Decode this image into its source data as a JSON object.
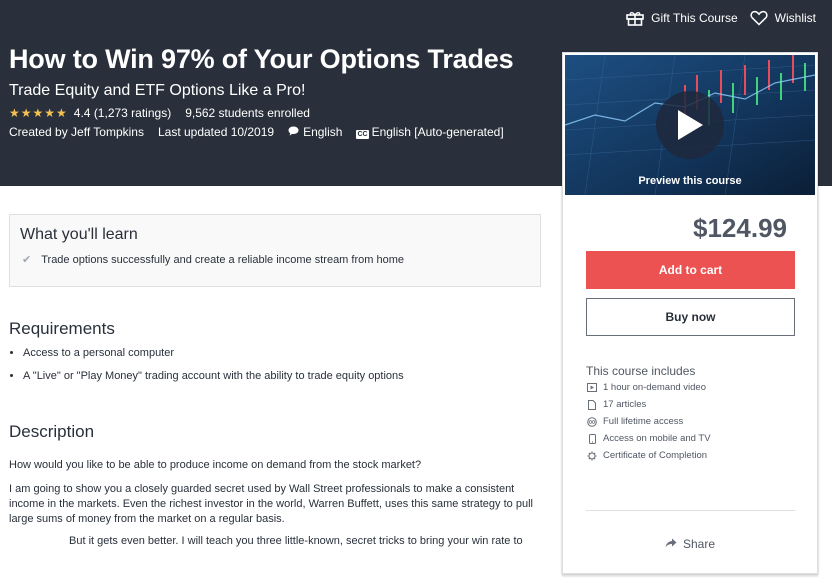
{
  "header": {
    "gift_label": "Gift This Course",
    "wishlist_label": "Wishlist",
    "title": "How to Win 97% of Your Options Trades",
    "subtitle": "Trade Equity and ETF Options Like a Pro!",
    "rating_stars": "★★★★★",
    "rating_text": "4.4 (1,273 ratings)",
    "students": "9,562 students enrolled",
    "created_by": "Created by Jeff Tompkins",
    "last_updated": "Last updated 10/2019",
    "language": "English",
    "captions": "English [Auto-generated]",
    "colors": {
      "background": "#29303b",
      "stars": "#f4c150"
    }
  },
  "sidebar": {
    "preview_label": "Preview this course",
    "price": "$124.99",
    "add_to_cart": "Add to cart",
    "buy_now": "Buy now",
    "includes_title": "This course includes",
    "includes": [
      {
        "icon": "video-icon",
        "text": "1 hour on-demand video"
      },
      {
        "icon": "file-icon",
        "text": "17 articles"
      },
      {
        "icon": "infinity-icon",
        "text": "Full lifetime access"
      },
      {
        "icon": "mobile-icon",
        "text": "Access on mobile and TV"
      },
      {
        "icon": "certificate-icon",
        "text": "Certificate of Completion"
      }
    ],
    "share_label": "Share",
    "colors": {
      "cart_button": "#ec5252"
    }
  },
  "learn": {
    "title": "What you'll learn",
    "items": [
      "Trade options successfully and create a reliable income stream from home"
    ]
  },
  "requirements": {
    "title": "Requirements",
    "items": [
      "Access to a personal computer",
      "A \"Live\" or \"Play Money\" trading account with the ability to trade equity options"
    ]
  },
  "description": {
    "title": "Description",
    "paragraphs": [
      "How would you like to be able to produce income on demand from the stock market?",
      "I am going to show you a closely guarded secret used by Wall Street professionals to make a consistent income in the markets.  Even the richest investor in the world, Warren Buffett, uses this same strategy to pull large sums of money from the market on a regular basis.",
      "But it gets even better. I will teach you three little-known, secret tricks to bring your win rate to"
    ]
  }
}
